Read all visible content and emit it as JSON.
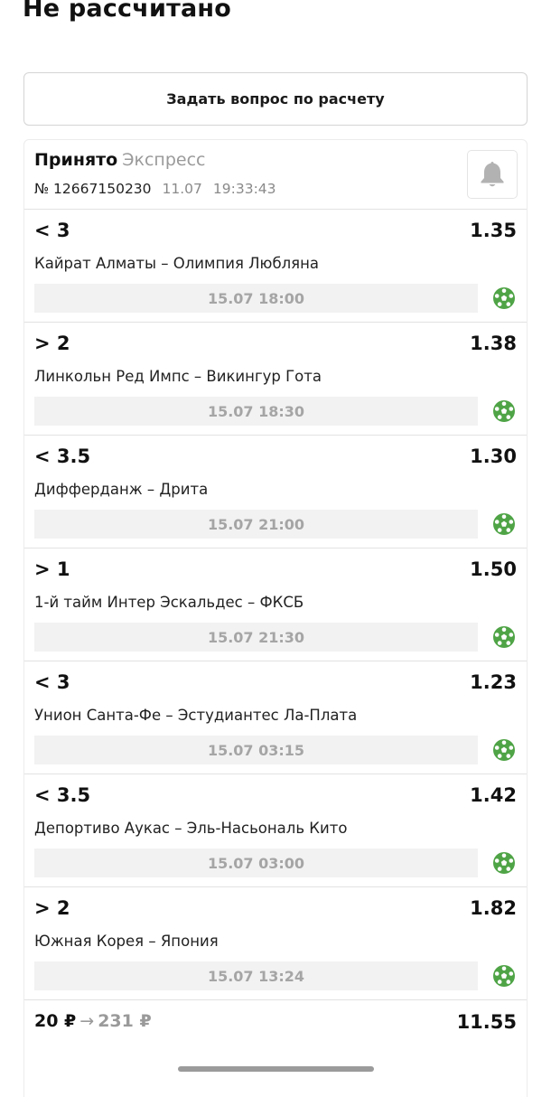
{
  "page_title": "Не рассчитано",
  "ask_button_label": "Задать вопрос по расчету",
  "bet": {
    "status": "Принято",
    "type": "Экспресс",
    "number": "№ 12667150230",
    "date": "11.07",
    "time": "19:33:43",
    "bell_icon": "bell-icon"
  },
  "events": [
    {
      "outcome": "< 3",
      "coef": "1.35",
      "match": "Кайрат Алматы – Олимпия Любляна",
      "datetime": "15.07 18:00",
      "sport_icon": "football-icon"
    },
    {
      "outcome": "> 2",
      "coef": "1.38",
      "match": "Линкольн Ред Импс – Викингур Гота",
      "datetime": "15.07 18:30",
      "sport_icon": "football-icon"
    },
    {
      "outcome": "< 3.5",
      "coef": "1.30",
      "match": "Дифферданж – Дрита",
      "datetime": "15.07 21:00",
      "sport_icon": "football-icon"
    },
    {
      "outcome": "> 1",
      "coef": "1.50",
      "match": "1-й тайм Интер Эскальдес – ФКСБ",
      "datetime": "15.07 21:30",
      "sport_icon": "football-icon"
    },
    {
      "outcome": "< 3",
      "coef": "1.23",
      "match": "Унион Санта-Фе – Эстудиантес Ла-Плата",
      "datetime": "15.07 03:15",
      "sport_icon": "football-icon"
    },
    {
      "outcome": "< 3.5",
      "coef": "1.42",
      "match": "Депортиво Аукас – Эль-Насьональ Кито",
      "datetime": "15.07 03:00",
      "sport_icon": "football-icon"
    },
    {
      "outcome": "> 2",
      "coef": "1.82",
      "match": "Южная Корея – Япония",
      "datetime": "15.07 13:24",
      "sport_icon": "football-icon"
    }
  ],
  "footer": {
    "stake": "20 ₽",
    "arrow": "→",
    "payout": "231 ₽",
    "total_coef": "11.55"
  },
  "colors": {
    "accent_green": "#4fa446",
    "date_bar_bg": "#f2f2f2",
    "muted_text": "#9a9a9a"
  }
}
